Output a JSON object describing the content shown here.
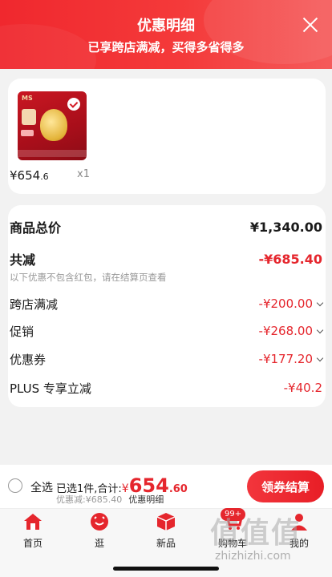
{
  "header": {
    "title": "优惠明细",
    "subtitle": "已享跨店满减，买得多省得多",
    "close_icon": "close-icon"
  },
  "product": {
    "brand": "MS",
    "price_int": "¥654",
    "price_dec": ".6",
    "quantity": "x1"
  },
  "details": {
    "total_label": "商品总价",
    "total_value": "¥1,340.00",
    "reduce_label": "共减",
    "reduce_value": "-¥685.40",
    "note": "以下优惠不包含红包，请在结算页查看",
    "items": [
      {
        "label": "跨店满减",
        "value": "-¥200.00"
      },
      {
        "label": "促销",
        "value": "-¥268.00"
      },
      {
        "label": "优惠券",
        "value": "-¥177.20"
      },
      {
        "label": "PLUS 专享立减",
        "value": "-¥40.2"
      }
    ]
  },
  "bottom": {
    "select_all": "全选",
    "selected_text": "已选1件,合计:",
    "currency": "¥",
    "amount_int": "654",
    "amount_dec": ".60",
    "discount_text": "优惠减:¥685.40",
    "detail_link": "优惠明细",
    "checkout_label": "领券结算"
  },
  "tabbar": {
    "items": [
      {
        "label": "首页",
        "icon": "home-icon"
      },
      {
        "label": "逛",
        "icon": "stroll-icon"
      },
      {
        "label": "新品",
        "icon": "box-icon"
      },
      {
        "label": "购物车",
        "icon": "cart-icon"
      },
      {
        "label": "我的",
        "icon": "user-icon"
      }
    ],
    "cart_badge": "99+"
  },
  "watermark": {
    "logo": "值值值",
    "site": "zhizhizhi.com"
  },
  "colors": {
    "accent": "#e5262d",
    "header_red": "#f0282e"
  }
}
